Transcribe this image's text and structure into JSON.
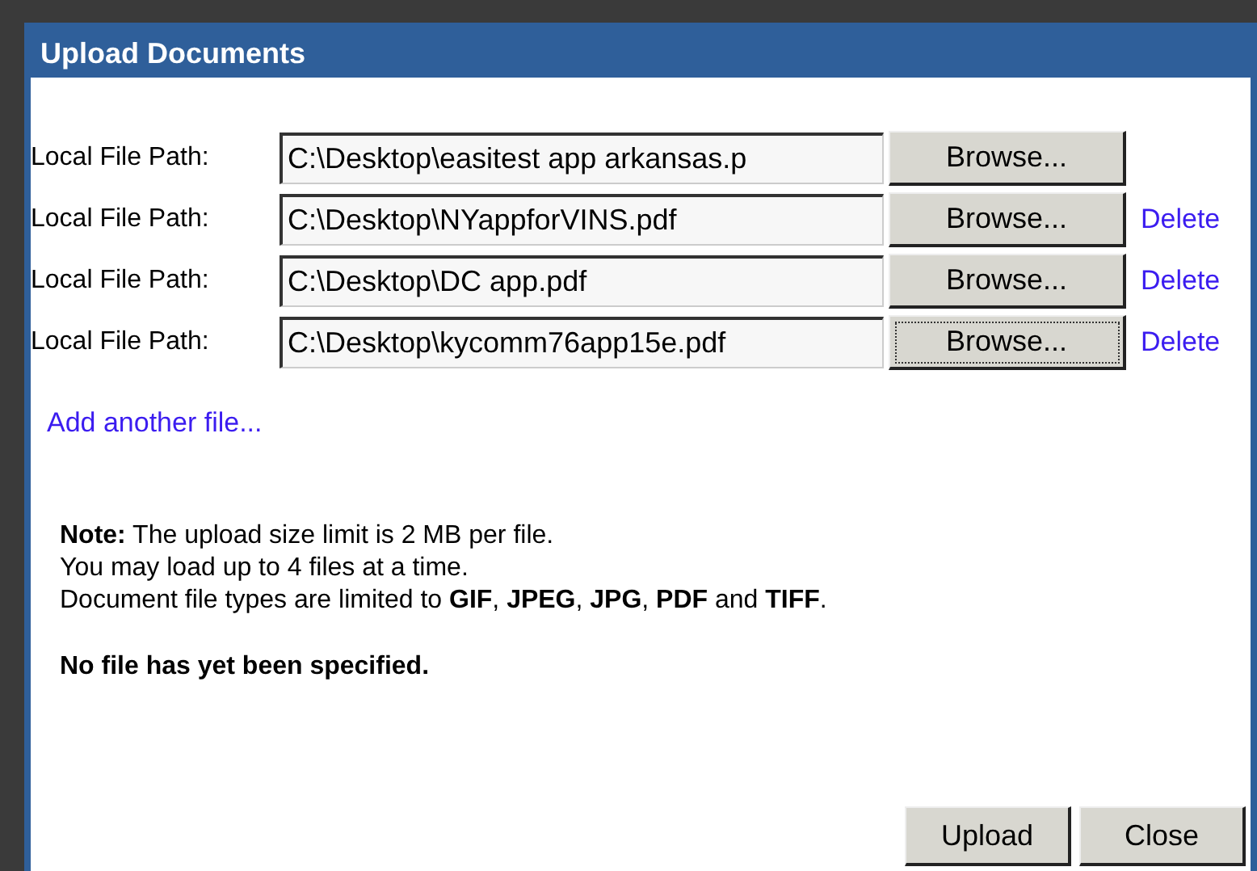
{
  "dialog": {
    "title": "Upload Documents"
  },
  "rows": [
    {
      "label": "Local File Path:",
      "value": "C:\\Desktop\\easitest app arkansas.p",
      "button": "Browse...",
      "focused": false
    },
    {
      "label": "Local File Path:",
      "value": "C:\\Desktop\\NYappforVINS.pdf",
      "button": "Browse...",
      "focused": false,
      "delete": "Delete"
    },
    {
      "label": "Local File Path:",
      "value": "C:\\Desktop\\DC app.pdf",
      "button": "Browse...",
      "focused": false,
      "delete": "Delete"
    },
    {
      "label": "Local File Path:",
      "value": "C:\\Desktop\\kycomm76app15e.pdf",
      "button": "Browse...",
      "focused": true,
      "delete": "Delete"
    }
  ],
  "add_link": "Add another file...",
  "note": [
    "**Note:** The upload size limit is 2 MB per file.",
    "You may load up to 4 files at a time.",
    "Document file types are limited to **GIF**, **JPEG**, **JPG**, **PDF** and **TIFF**."
  ],
  "status": "No file has yet been specified.",
  "buttons": [
    "Upload",
    "Close"
  ]
}
